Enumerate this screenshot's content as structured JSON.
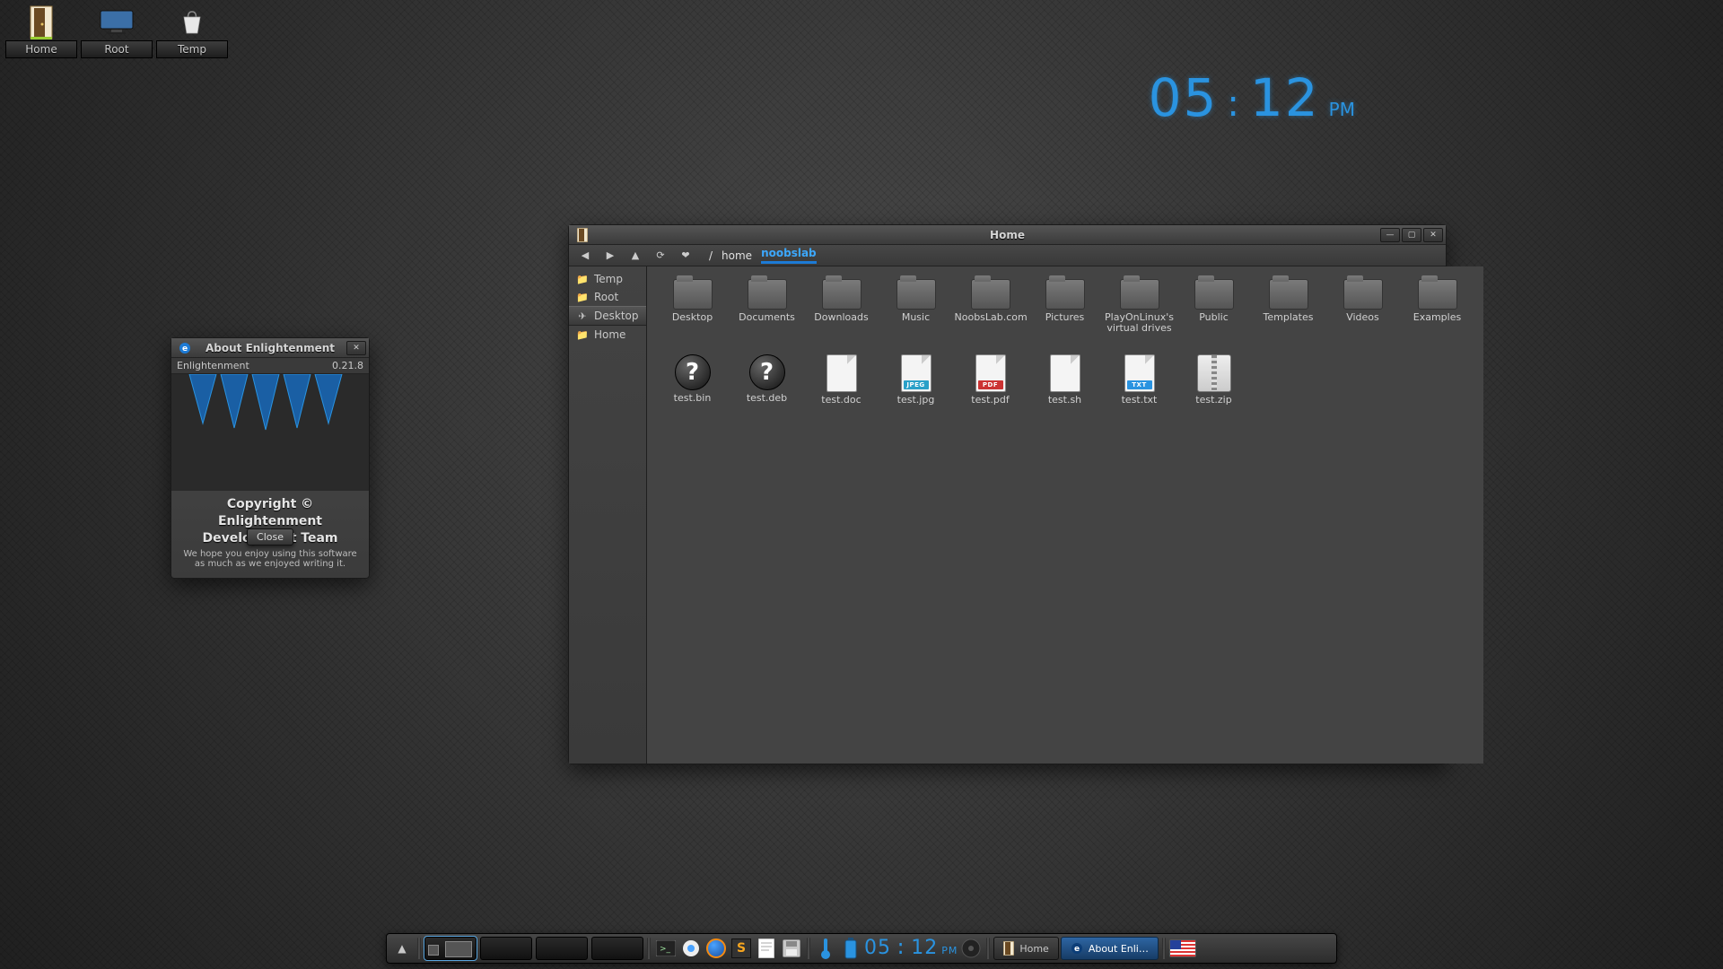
{
  "desktop": {
    "icons": [
      {
        "id": "home",
        "label": "Home"
      },
      {
        "id": "root",
        "label": "Root"
      },
      {
        "id": "temp",
        "label": "Temp"
      }
    ]
  },
  "big_clock": {
    "hh": "05",
    "mm": "12",
    "ampm": "PM"
  },
  "about": {
    "title": "About Enlightenment",
    "name": "Enlightenment",
    "version": "0.21.8",
    "copyright_l1": "Copyright ©",
    "copyright_l2": "Enlightenment",
    "copyright_l3": "Development Team",
    "msg": "We hope you enjoy using this software as much as we enjoyed writing it.",
    "close": "Close"
  },
  "fm": {
    "title": "Home",
    "toolbar": {
      "back": "◀",
      "fwd": "▶",
      "up": "▲",
      "reload": "⟳",
      "fav": "❤"
    },
    "breadcrumbs": [
      {
        "label": "/",
        "current": false
      },
      {
        "label": "home",
        "current": false
      },
      {
        "label": "noobslab",
        "current": true
      }
    ],
    "sidebar": [
      {
        "label": "Temp",
        "icon": "📁",
        "sel": false
      },
      {
        "label": "Root",
        "icon": "📁",
        "sel": false
      },
      {
        "label": "Desktop",
        "icon": "✈",
        "sel": true
      },
      {
        "label": "Home",
        "icon": "📁",
        "sel": false
      }
    ],
    "items": [
      {
        "name": "Desktop",
        "type": "folder"
      },
      {
        "name": "Documents",
        "type": "folder"
      },
      {
        "name": "Downloads",
        "type": "folder"
      },
      {
        "name": "Music",
        "type": "folder"
      },
      {
        "name": "NoobsLab.com",
        "type": "folder"
      },
      {
        "name": "Pictures",
        "type": "folder"
      },
      {
        "name": "PlayOnLinux's virtual drives",
        "type": "folder"
      },
      {
        "name": "Public",
        "type": "folder"
      },
      {
        "name": "Templates",
        "type": "folder"
      },
      {
        "name": "Videos",
        "type": "folder"
      },
      {
        "name": "Examples",
        "type": "folder"
      },
      {
        "name": "test.bin",
        "type": "unknown"
      },
      {
        "name": "test.deb",
        "type": "unknown"
      },
      {
        "name": "test.doc",
        "type": "doc",
        "tag": "",
        "tagc": "#2f5fb8"
      },
      {
        "name": "test.jpg",
        "type": "doc",
        "tag": "JPEG",
        "tagc": "#2aa0c8"
      },
      {
        "name": "test.pdf",
        "type": "doc",
        "tag": "PDF",
        "tagc": "#c33"
      },
      {
        "name": "test.sh",
        "type": "doc",
        "tag": "",
        "tagc": "#888"
      },
      {
        "name": "test.txt",
        "type": "doc",
        "tag": "TXT",
        "tagc": "#2a93e0"
      },
      {
        "name": "test.zip",
        "type": "zip"
      }
    ]
  },
  "shelf": {
    "start": "▲",
    "tray_icons": [
      "terminal",
      "hexchat",
      "firefox",
      "sublime",
      "text-editor",
      "floppy"
    ],
    "clock": {
      "hh": "05",
      "mm": "12",
      "ampm": "PM"
    },
    "tasks": [
      {
        "label": "Home",
        "active": false
      },
      {
        "label": "About Enli…",
        "active": true
      }
    ]
  }
}
